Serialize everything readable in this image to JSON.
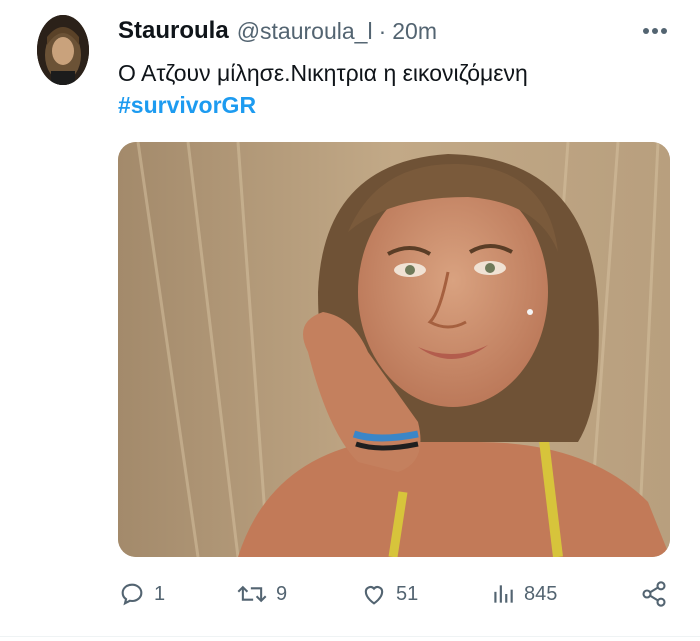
{
  "author": {
    "display_name": "Stauroula",
    "handle": "@stauroula_l",
    "separator": "·",
    "time": "20m",
    "avatar_icon": "profile-photo"
  },
  "tweet": {
    "text": "Ο Ατζουν μίλησε.Νικητρια η εικονιζόμενη",
    "hashtag": "#survivorGR",
    "media_description_icon": "photo-woman-resting-chin-on-hand"
  },
  "actions": {
    "replies": {
      "icon": "reply-icon",
      "count": "1"
    },
    "retweets": {
      "icon": "retweet-icon",
      "count": "9"
    },
    "likes": {
      "icon": "heart-icon",
      "count": "51"
    },
    "views": {
      "icon": "views-bar-chart-icon",
      "count": "845"
    },
    "share": {
      "icon": "share-icon"
    }
  },
  "colors": {
    "text": "#0f1419",
    "secondary": "#536471",
    "accent": "#1d9bf0"
  }
}
